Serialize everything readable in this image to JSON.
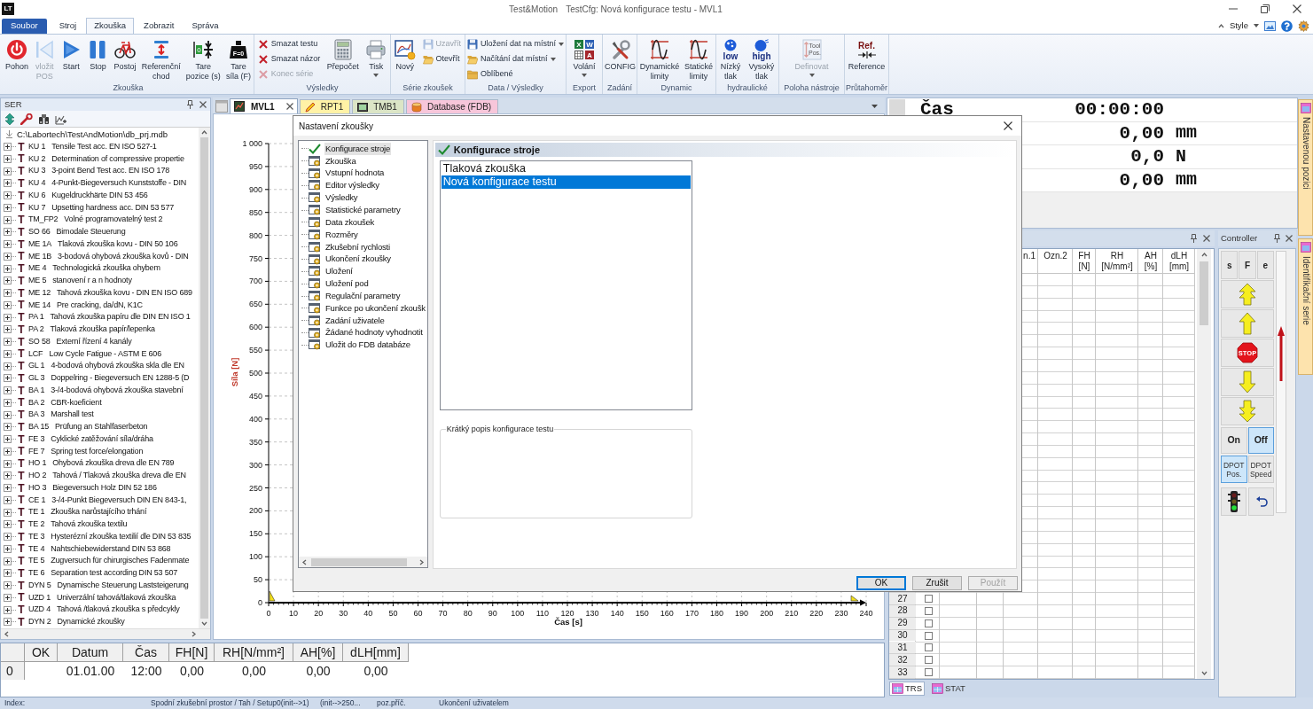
{
  "window": {
    "logo": "LT",
    "app_name": "Test&Motion",
    "title": "TestCfg: Nová konfigurace testu - MVL1"
  },
  "ribbon": {
    "tabs": [
      {
        "label": "Soubor",
        "kind": "file",
        "selected": false
      },
      {
        "label": "Stroj",
        "kind": "tab",
        "selected": false
      },
      {
        "label": "Zkouška",
        "kind": "tab",
        "selected": true
      },
      {
        "label": "Zobrazit",
        "kind": "tab",
        "selected": false
      },
      {
        "label": "Správa",
        "kind": "tab",
        "selected": false
      }
    ],
    "style_menu": "Style",
    "groups": [
      {
        "label": "Zkouška",
        "items": [
          {
            "kind": "large",
            "label": "Pohon",
            "disabled": false
          },
          {
            "kind": "large",
            "label": "vložit\nPOS",
            "disabled": true
          },
          {
            "kind": "large",
            "label": "Start",
            "disabled": false
          },
          {
            "kind": "large",
            "label": "Stop",
            "disabled": false
          },
          {
            "kind": "large",
            "label": "Postoj",
            "disabled": false
          },
          {
            "kind": "large",
            "label": "Referenční\nchod",
            "disabled": false
          },
          {
            "kind": "large",
            "label": "Tare\npozice (s)",
            "disabled": false,
            "icon_text": [
              "0"
            ]
          },
          {
            "kind": "large",
            "label": "Tare\nsíla (F)",
            "disabled": false,
            "icon_text": [
              "F=0"
            ]
          }
        ]
      },
      {
        "label": "Výsledky",
        "items": [
          {
            "kind": "small",
            "label": "Smazat testu",
            "disabled": false
          },
          {
            "kind": "small",
            "label": "Smazat názor",
            "disabled": false
          },
          {
            "kind": "small",
            "label": "Konec série",
            "disabled": true
          },
          {
            "kind": "large",
            "label": "Přepočet",
            "disabled": false
          },
          {
            "kind": "large",
            "label": "Tisk",
            "disabled": false,
            "dropdown": true
          }
        ]
      },
      {
        "label": "Série zkoušek",
        "items": [
          {
            "kind": "large",
            "label": "Nový",
            "disabled": false
          },
          {
            "kind": "small",
            "label": "Uzavřít",
            "disabled": true
          },
          {
            "kind": "small",
            "label": "Otevřít",
            "disabled": false
          }
        ]
      },
      {
        "label": "Data / Výsledky",
        "items": [
          {
            "kind": "small",
            "label": "Uložení dat na místní",
            "disabled": false,
            "dropdown": true
          },
          {
            "kind": "small",
            "label": "Načítání dat místní",
            "disabled": false,
            "dropdown": true
          },
          {
            "kind": "small",
            "label": "Oblíbené",
            "disabled": false
          }
        ]
      },
      {
        "label": "Export",
        "items": [
          {
            "kind": "large",
            "label": "Volání",
            "disabled": false,
            "dropdown": true,
            "icon_text": [
              "X",
              "W",
              "A"
            ]
          }
        ]
      },
      {
        "label": "Zadání",
        "items": [
          {
            "kind": "large",
            "label": "CONFIG",
            "disabled": false
          }
        ]
      },
      {
        "label": "Dynamic",
        "items": [
          {
            "kind": "large",
            "label": "Dynamické\nlimity",
            "disabled": false
          },
          {
            "kind": "large",
            "label": "Statické\nlimity",
            "disabled": false
          }
        ]
      },
      {
        "label": "hydraulické",
        "items": [
          {
            "kind": "large",
            "label": "Nízký\ntlak",
            "disabled": false,
            "icon_text": [
              "low"
            ]
          },
          {
            "kind": "large",
            "label": "Vysoký\ntlak",
            "disabled": false,
            "icon_text": [
              "high"
            ]
          }
        ]
      },
      {
        "label": "Poloha nástroje",
        "items": [
          {
            "kind": "large",
            "label": "Definovat",
            "disabled": true,
            "dropdown": true,
            "icon_text": [
              "Tool",
              "Pos."
            ]
          }
        ]
      },
      {
        "label": "Průtahoměr",
        "items": [
          {
            "kind": "large",
            "label": "Reference",
            "disabled": false,
            "icon_text": [
              "Ref."
            ]
          }
        ]
      }
    ]
  },
  "ser_panel": {
    "title": "SER",
    "root": "C:\\Labortech\\TestAndMotion\\db_prj.mdb",
    "items": [
      {
        "mark": "T",
        "code": "KU 1",
        "name": "Tensile Test acc. EN ISO 527-1",
        "expanded": false
      },
      {
        "mark": "T",
        "code": "KU 2",
        "name": "Determination of compressive propertie",
        "expanded": false
      },
      {
        "mark": "T",
        "code": "KU 3",
        "name": "3-point Bend Test acc. EN ISO 178",
        "expanded": false
      },
      {
        "mark": "T",
        "code": "KU 4",
        "name": "4-Punkt-Biegeversuch Kunststoffe - DIN",
        "expanded": false
      },
      {
        "mark": "T",
        "code": "KU 6",
        "name": "Kugeldruckhärte DIN 53 456",
        "expanded": false
      },
      {
        "mark": "T",
        "code": "KU 7",
        "name": "Upsetting hardness acc. DIN 53 577",
        "expanded": false
      },
      {
        "mark": "T",
        "code": "TM_FP2",
        "name": "Volné programovatelný test 2",
        "expanded": false
      },
      {
        "mark": "T",
        "code": "SO 66",
        "name": "Bimodale Steuerung",
        "expanded": false
      },
      {
        "mark": "T",
        "code": "ME 1A",
        "name": "Tlaková zkouška kovu - DIN 50 106",
        "expanded": false
      },
      {
        "mark": "T",
        "code": "ME 1B",
        "name": "3-bodová ohybová zkouška kovů - DIN",
        "expanded": false
      },
      {
        "mark": "T",
        "code": "ME 4",
        "name": "Technologická zkouška ohybem",
        "expanded": false
      },
      {
        "mark": "T",
        "code": "ME 5",
        "name": "stanovení r a n hodnoty",
        "expanded": false
      },
      {
        "mark": "T",
        "code": "ME 12",
        "name": "Tahová zkouška kovu - DIN EN ISO 689",
        "expanded": false
      },
      {
        "mark": "T",
        "code": "ME 14",
        "name": "Pre cracking, da/dN, K1C",
        "expanded": false
      },
      {
        "mark": "T",
        "code": "PA 1",
        "name": "Tahová zkouška papíru dle DIN EN ISO 1",
        "expanded": false
      },
      {
        "mark": "T",
        "code": "PA 2",
        "name": "Tlaková zkouška papír/lepenka",
        "expanded": false
      },
      {
        "mark": "T",
        "code": "SO 58",
        "name": "Externí řízení 4 kanály",
        "expanded": false
      },
      {
        "mark": "T",
        "code": "LCF",
        "name": "Low Cycle Fatigue - ASTM E 606",
        "expanded": false
      },
      {
        "mark": "T",
        "code": "GL 1",
        "name": "4-bodová ohybová zkouška skla dle EN",
        "expanded": false
      },
      {
        "mark": "T",
        "code": "GL 3",
        "name": "Doppelring - Biegeversuch EN 1288-5 (D",
        "expanded": false
      },
      {
        "mark": "T",
        "code": "BA 1",
        "name": "3-/4-bodová ohybová zkouška stavební",
        "expanded": false
      },
      {
        "mark": "T",
        "code": "BA 2",
        "name": "CBR-koeficient",
        "expanded": false
      },
      {
        "mark": "T",
        "code": "BA 3",
        "name": "Marshall test",
        "expanded": false
      },
      {
        "mark": "T",
        "code": "BA 15",
        "name": "Prüfung an Stahlfaserbeton",
        "expanded": false
      },
      {
        "mark": "T",
        "code": "FE 3",
        "name": "Cyklické zatěžování síla/dráha",
        "expanded": false
      },
      {
        "mark": "T",
        "code": "FE 7",
        "name": "Spring test force/elongation",
        "expanded": false
      },
      {
        "mark": "T",
        "code": "HO 1",
        "name": "Ohybová zkouška dreva dle EN 789",
        "expanded": false
      },
      {
        "mark": "T",
        "code": "HO 2",
        "name": "Tahová / Tlaková zkouška dreva dle EN",
        "expanded": false
      },
      {
        "mark": "T",
        "code": "HO 3",
        "name": "Biegeversuch Holz DIN 52 186",
        "expanded": false
      },
      {
        "mark": "T",
        "code": "CE 1",
        "name": "3-/4-Punkt Biegeversuch DIN EN 843-1,",
        "expanded": false
      },
      {
        "mark": "T",
        "code": "TE 1",
        "name": "Zkouška narůstajícího trhání",
        "expanded": false
      },
      {
        "mark": "T",
        "code": "TE 2",
        "name": "Tahová zkouška textilu",
        "expanded": false
      },
      {
        "mark": "T",
        "code": "TE 3",
        "name": "Hysterézní zkouška textilií dle DIN 53 835",
        "expanded": false
      },
      {
        "mark": "T",
        "code": "TE 4",
        "name": "Nahtschiebewiderstand DIN 53 868",
        "expanded": false
      },
      {
        "mark": "T",
        "code": "TE 5",
        "name": "Zugversuch für chirurgisches Fadenmate",
        "expanded": false
      },
      {
        "mark": "T",
        "code": "TE 6",
        "name": "Separation test according DIN 53 507",
        "expanded": false
      },
      {
        "mark": "T",
        "code": "DYN 5",
        "name": "Dynamische Steuerung Laststeigerung",
        "expanded": false
      },
      {
        "mark": "T",
        "code": "UZD 1",
        "name": "Univerzální tahová/tlaková zkouška",
        "expanded": false
      },
      {
        "mark": "T",
        "code": "UZD 4",
        "name": "Tahová /tlaková zkouška s předcykly",
        "expanded": false
      },
      {
        "mark": "T",
        "code": "DYN 2",
        "name": "Dynamické zkoušky",
        "expanded": false
      }
    ]
  },
  "chart": {
    "tabs": [
      {
        "label": "MVL1",
        "selected": true,
        "closable": true,
        "color": "#ffffff"
      },
      {
        "label": "RPT1",
        "selected": false,
        "closable": false,
        "color": "#fff2a6"
      },
      {
        "label": "TMB1",
        "selected": false,
        "closable": false,
        "color": "#dbe5c6"
      },
      {
        "label": "Database (FDB)",
        "selected": false,
        "closable": false,
        "color": "#f7c6da"
      }
    ],
    "chart_data": {
      "type": "line",
      "grid": true,
      "xlabel": "Čas [s]",
      "ylabel": "Síla [N]",
      "xlim": [
        0,
        240
      ],
      "ylim": [
        0,
        1000
      ],
      "xticks": [
        0,
        10,
        20,
        30,
        40,
        50,
        60,
        70,
        80,
        90,
        100,
        110,
        120,
        130,
        140,
        150,
        160,
        170,
        180,
        190,
        200,
        210,
        220,
        230,
        240
      ],
      "yticks": [
        0,
        50,
        100,
        150,
        200,
        250,
        300,
        350,
        400,
        450,
        500,
        550,
        600,
        650,
        700,
        750,
        800,
        850,
        900,
        950,
        {
          "value": 1000,
          "label": "1 000"
        }
      ]
    }
  },
  "readouts": [
    {
      "label": "Čas",
      "value": "00:00:00"
    },
    {
      "value": "0,00",
      "unit": "mm"
    },
    {
      "value": "0,0",
      "unit": "N"
    },
    {
      "value": "0,00",
      "unit": "mm"
    }
  ],
  "test_table": {
    "columns": [
      "n.1",
      "Ozn.2",
      "FH\n[N]",
      "RH\n[N/mm²]",
      "AH\n[%]",
      "dLH\n[mm]"
    ],
    "rows": [
      {
        "number": "27",
        "checked": false
      },
      {
        "number": "28",
        "checked": false
      },
      {
        "number": "29",
        "checked": false
      },
      {
        "number": "30",
        "checked": false
      },
      {
        "number": "31",
        "checked": false
      },
      {
        "number": "32",
        "checked": false
      },
      {
        "number": "33",
        "checked": false
      }
    ],
    "tabs": [
      {
        "label": "TRS",
        "selected": true
      },
      {
        "label": "STAT",
        "selected": false
      }
    ]
  },
  "controller": {
    "title": "Controller",
    "mode_buttons": [
      {
        "label": "s"
      },
      {
        "label": "F"
      },
      {
        "label": "e"
      }
    ],
    "stop_sign": "STOP",
    "drive": [
      {
        "label": "On",
        "selected": false
      },
      {
        "label": "Off",
        "selected": true
      }
    ],
    "dpot": [
      {
        "label": "DPOT\nPos.",
        "selected": true
      },
      {
        "label": "DPOT\nSpeed",
        "selected": false
      }
    ]
  },
  "side_tabs": [
    {
      "label": "Nastavenou pozici"
    },
    {
      "label": "Identifikační serie"
    }
  ],
  "series_table": {
    "columns": [
      "OK",
      "Datum",
      "Čas",
      "FH[N]",
      "RH[N/mm²]",
      "AH[%]",
      "dLH[mm]"
    ],
    "rows": [
      {
        "number": "0",
        "cells": [
          null,
          "01.01.00",
          "12:00",
          "0,00",
          "0,00",
          "0,00",
          "0,00"
        ]
      }
    ]
  },
  "status_bar": [
    "Index:",
    "Spodní zkušební prostor / Tah / Setup0(init-->1)",
    "(init-->250...",
    "poz.příč.",
    "Ukončení uživatelem"
  ],
  "dialog": {
    "title": "Nastavení zkoušky",
    "nav": [
      {
        "label": "Konfigurace stroje",
        "selected": true,
        "checked": true
      },
      {
        "label": "Zkouška",
        "selected": false,
        "checked": false
      },
      {
        "label": "Vstupní hodnota",
        "selected": false,
        "checked": false
      },
      {
        "label": "Editor výsledky",
        "selected": false,
        "checked": false
      },
      {
        "label": "Výsledky",
        "selected": false,
        "checked": false
      },
      {
        "label": "Statistické parametry",
        "selected": false,
        "checked": false
      },
      {
        "label": "Data zkoušek",
        "selected": false,
        "checked": false
      },
      {
        "label": "Rozměry",
        "selected": false,
        "checked": false
      },
      {
        "label": "Zkušební rychlosti",
        "selected": false,
        "checked": false
      },
      {
        "label": "Ukončení zkoušky",
        "selected": false,
        "checked": false
      },
      {
        "label": "Uložení",
        "selected": false,
        "checked": false
      },
      {
        "label": "Uložení pod",
        "selected": false,
        "checked": false
      },
      {
        "label": "Regulační parametry",
        "selected": false,
        "checked": false
      },
      {
        "label": "Funkce po ukončení zkoušk",
        "selected": false,
        "checked": false
      },
      {
        "label": "Zadání uživatele",
        "selected": false,
        "checked": false
      },
      {
        "label": "Žádané hodnoty vyhodnotit",
        "selected": false,
        "checked": false
      },
      {
        "label": "Uložit do FDB databáze",
        "selected": false,
        "checked": false
      }
    ],
    "section_title": "Konfigurace stroje",
    "configurations": [
      {
        "label": "Tlaková zkouška",
        "selected": false
      },
      {
        "label": "Nová konfigurace testu",
        "selected": true
      }
    ],
    "description_label": "Krátký popis konfigurace testu",
    "buttons": [
      {
        "label": "OK",
        "default": true,
        "disabled": false
      },
      {
        "label": "Zrušit",
        "default": false,
        "disabled": false
      },
      {
        "label": "Použít",
        "default": false,
        "disabled": true
      }
    ]
  }
}
